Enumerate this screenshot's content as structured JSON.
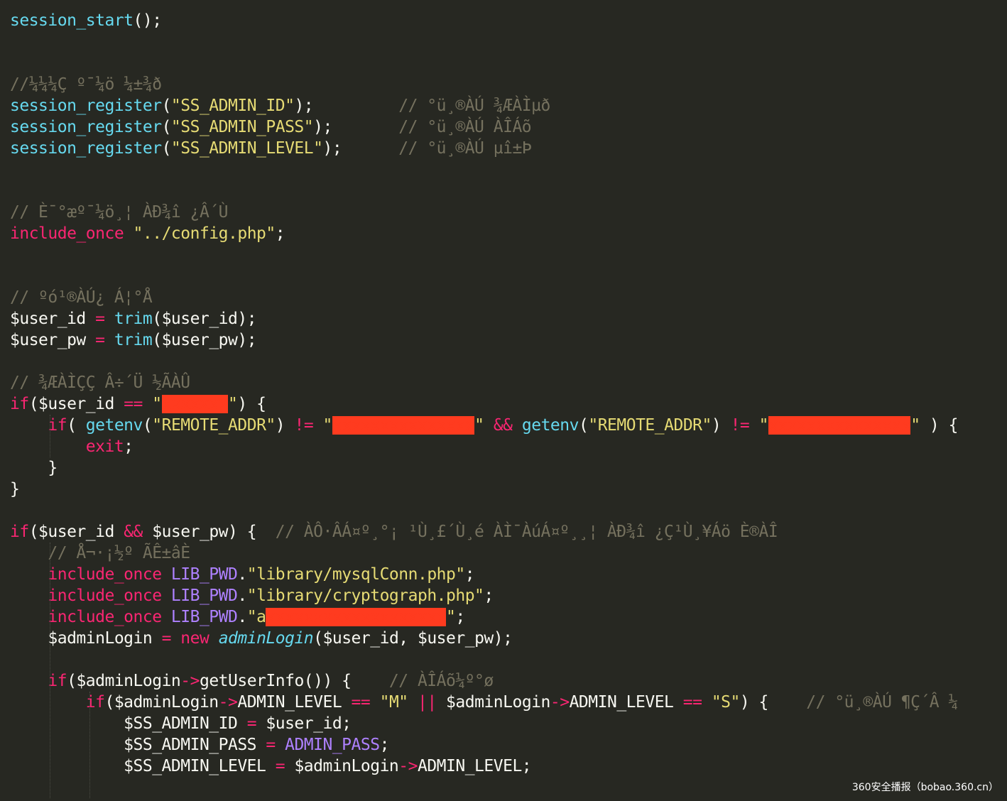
{
  "colors": {
    "background": "#272822",
    "plain": "#f8f8f2",
    "function": "#66d9ef",
    "keyword": "#f92672",
    "string": "#e6db74",
    "comment": "#75715e",
    "constant": "#ae81ff",
    "redaction": "#ff3b1f"
  },
  "code_lines": [
    [
      [
        "func",
        "session_start"
      ],
      [
        "plain",
        "();"
      ]
    ],
    [],
    [],
    [
      [
        "cmt",
        "//¼¼¼Ç º¯¼ö ¼±¾ð"
      ]
    ],
    [
      [
        "func",
        "session_register"
      ],
      [
        "plain",
        "("
      ],
      [
        "str",
        "\"SS_ADMIN_ID\""
      ],
      [
        "plain",
        ");"
      ],
      [
        "plain",
        "         "
      ],
      [
        "cmt",
        "// °ü¸®ÀÚ ¾ÆÀÌµð"
      ]
    ],
    [
      [
        "func",
        "session_register"
      ],
      [
        "plain",
        "("
      ],
      [
        "str",
        "\"SS_ADMIN_PASS\""
      ],
      [
        "plain",
        ");"
      ],
      [
        "plain",
        "       "
      ],
      [
        "cmt",
        "// °ü¸®ÀÚ ÀÎÁõ"
      ]
    ],
    [
      [
        "func",
        "session_register"
      ],
      [
        "plain",
        "("
      ],
      [
        "str",
        "\"SS_ADMIN_LEVEL\""
      ],
      [
        "plain",
        ");"
      ],
      [
        "plain",
        "      "
      ],
      [
        "cmt",
        "// °ü¸®ÀÚ µî±Þ"
      ]
    ],
    [],
    [],
    [
      [
        "cmt",
        "// È¯°æº¯¼ö¸¦ ÀÐ¾î ¿Â´Ù"
      ]
    ],
    [
      [
        "kw",
        "include_once"
      ],
      [
        "plain",
        " "
      ],
      [
        "str",
        "\"../config.php\""
      ],
      [
        "plain",
        ";"
      ]
    ],
    [],
    [],
    [
      [
        "cmt",
        "// ºó¹®ÀÚ¿ Á¦°Å"
      ]
    ],
    [
      [
        "plain",
        "$user_id "
      ],
      [
        "op",
        "="
      ],
      [
        "plain",
        " "
      ],
      [
        "func",
        "trim"
      ],
      [
        "plain",
        "($user_id);"
      ]
    ],
    [
      [
        "plain",
        "$user_pw "
      ],
      [
        "op",
        "="
      ],
      [
        "plain",
        " "
      ],
      [
        "func",
        "trim"
      ],
      [
        "plain",
        "($user_pw);"
      ]
    ],
    [],
    [
      [
        "cmt",
        "// ¾ÆÀÌÇÇ Â÷´Ü ½ÃÀÛ"
      ]
    ],
    [
      [
        "kw",
        "if"
      ],
      [
        "plain",
        "($user_id "
      ],
      [
        "op",
        "=="
      ],
      [
        "plain",
        " "
      ],
      [
        "str",
        "\""
      ],
      [
        "redact",
        "xxxxxxx"
      ],
      [
        "str",
        "\""
      ],
      [
        "plain",
        ") {"
      ]
    ],
    [
      [
        "plain",
        "    "
      ],
      [
        "kw",
        "if"
      ],
      [
        "plain",
        "( "
      ],
      [
        "func",
        "getenv"
      ],
      [
        "plain",
        "("
      ],
      [
        "str",
        "\"REMOTE_ADDR\""
      ],
      [
        "plain",
        ") "
      ],
      [
        "op",
        "!="
      ],
      [
        "plain",
        " "
      ],
      [
        "str",
        "\""
      ],
      [
        "redact",
        "xxxxxxxxxxxxxxx"
      ],
      [
        "str",
        "\""
      ],
      [
        "plain",
        " "
      ],
      [
        "op",
        "&&"
      ],
      [
        "plain",
        " "
      ],
      [
        "func",
        "getenv"
      ],
      [
        "plain",
        "("
      ],
      [
        "str",
        "\"REMOTE_ADDR\""
      ],
      [
        "plain",
        ") "
      ],
      [
        "op",
        "!="
      ],
      [
        "plain",
        " "
      ],
      [
        "str",
        "\""
      ],
      [
        "redact",
        "xxxxxxxxxxxxxxx"
      ],
      [
        "str",
        "\""
      ],
      [
        "plain",
        " ) {"
      ]
    ],
    [
      [
        "plain",
        "        "
      ],
      [
        "kw",
        "exit"
      ],
      [
        "plain",
        ";"
      ]
    ],
    [
      [
        "plain",
        "    }"
      ]
    ],
    [
      [
        "plain",
        "}"
      ]
    ],
    [],
    [
      [
        "kw",
        "if"
      ],
      [
        "plain",
        "($user_id "
      ],
      [
        "op",
        "&&"
      ],
      [
        "plain",
        " $user_pw) {  "
      ],
      [
        "cmt",
        "// ÀÔ·ÂÁ¤º¸°¡ ¹Ù¸£´Ù¸é ÀÌ¯ÀúÁ¤º¸¸¦ ÀÐ¾î ¿Ç¹Ù¸¥Áö È®ÀÎ"
      ]
    ],
    [
      [
        "plain",
        "    "
      ],
      [
        "cmt",
        "// Å¬·¡½º ÃÊ±âÈ"
      ]
    ],
    [
      [
        "plain",
        "    "
      ],
      [
        "kw",
        "include_once"
      ],
      [
        "plain",
        " "
      ],
      [
        "const",
        "LIB_PWD"
      ],
      [
        "plain",
        "."
      ],
      [
        "str",
        "\"library/mysqlConn.php\""
      ],
      [
        "plain",
        ";"
      ]
    ],
    [
      [
        "plain",
        "    "
      ],
      [
        "kw",
        "include_once"
      ],
      [
        "plain",
        " "
      ],
      [
        "const",
        "LIB_PWD"
      ],
      [
        "plain",
        "."
      ],
      [
        "str",
        "\"library/cryptograph.php\""
      ],
      [
        "plain",
        ";"
      ]
    ],
    [
      [
        "plain",
        "    "
      ],
      [
        "kw",
        "include_once"
      ],
      [
        "plain",
        " "
      ],
      [
        "const",
        "LIB_PWD"
      ],
      [
        "plain",
        "."
      ],
      [
        "str",
        "\"a"
      ],
      [
        "redact",
        "xxxxxxxxxxxxxxxxxxx"
      ],
      [
        "str",
        "\""
      ],
      [
        "plain",
        ";"
      ]
    ],
    [
      [
        "plain",
        "    $adminLogin "
      ],
      [
        "op",
        "="
      ],
      [
        "plain",
        " "
      ],
      [
        "kw",
        "new"
      ],
      [
        "plain",
        " "
      ],
      [
        "cls",
        "adminLogin"
      ],
      [
        "plain",
        "($user_id, $user_pw);"
      ]
    ],
    [],
    [
      [
        "plain",
        "    "
      ],
      [
        "kw",
        "if"
      ],
      [
        "plain",
        "($adminLogin"
      ],
      [
        "op",
        "->"
      ],
      [
        "plain",
        "getUserInfo()) {    "
      ],
      [
        "cmt",
        "// ÀÎÁõ¼º°ø"
      ]
    ],
    [
      [
        "plain",
        "        "
      ],
      [
        "kw",
        "if"
      ],
      [
        "plain",
        "($adminLogin"
      ],
      [
        "op",
        "->"
      ],
      [
        "plain",
        "ADMIN_LEVEL "
      ],
      [
        "op",
        "=="
      ],
      [
        "plain",
        " "
      ],
      [
        "str",
        "\"M\""
      ],
      [
        "plain",
        " "
      ],
      [
        "op",
        "||"
      ],
      [
        "plain",
        " $adminLogin"
      ],
      [
        "op",
        "->"
      ],
      [
        "plain",
        "ADMIN_LEVEL "
      ],
      [
        "op",
        "=="
      ],
      [
        "plain",
        " "
      ],
      [
        "str",
        "\"S\""
      ],
      [
        "plain",
        ") {    "
      ],
      [
        "cmt",
        "// °ü¸®ÀÚ ¶Ç´Â ¼"
      ]
    ],
    [
      [
        "plain",
        "            $SS_ADMIN_ID "
      ],
      [
        "op",
        "="
      ],
      [
        "plain",
        " $user_id;"
      ]
    ],
    [
      [
        "plain",
        "            $SS_ADMIN_PASS "
      ],
      [
        "op",
        "="
      ],
      [
        "plain",
        " "
      ],
      [
        "const",
        "ADMIN_PASS"
      ],
      [
        "plain",
        ";"
      ]
    ],
    [
      [
        "plain",
        "            $SS_ADMIN_LEVEL "
      ],
      [
        "op",
        "="
      ],
      [
        "plain",
        " $adminLogin"
      ],
      [
        "op",
        "->"
      ],
      [
        "plain",
        "ADMIN_LEVEL;"
      ]
    ],
    []
  ],
  "watermark": "360安全播报（bobao.360.cn）"
}
